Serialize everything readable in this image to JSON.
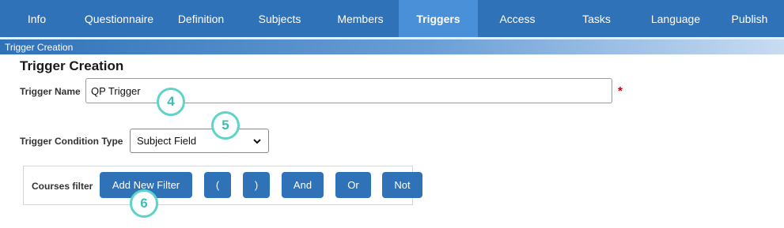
{
  "nav": {
    "tabs": [
      {
        "label": "Info"
      },
      {
        "label": "Questionnaire"
      },
      {
        "label": "Definition"
      },
      {
        "label": "Subjects"
      },
      {
        "label": "Members"
      },
      {
        "label": "Triggers"
      },
      {
        "label": "Access"
      },
      {
        "label": "Tasks"
      },
      {
        "label": "Language"
      },
      {
        "label": "Publish"
      }
    ],
    "active_tab": "Triggers"
  },
  "breadcrumb": "Trigger Creation",
  "page_title": "Trigger Creation",
  "trigger_name": {
    "label": "Trigger Name",
    "value": "QP Trigger",
    "required_marker": "*"
  },
  "condition_type": {
    "label": "Trigger Condition Type",
    "selected": "Subject Field"
  },
  "filter": {
    "label": "Courses filter",
    "buttons": {
      "add": "Add New Filter",
      "open_paren": "(",
      "close_paren": ")",
      "and": "And",
      "or": "Or",
      "not": "Not"
    }
  },
  "steps": [
    "4",
    "5",
    "6"
  ],
  "colors": {
    "nav_bg": "#2f72b8",
    "nav_active": "#4a90d9",
    "button": "#2f72b8",
    "step_marker": "#5fd3c7",
    "required": "#c00000"
  }
}
